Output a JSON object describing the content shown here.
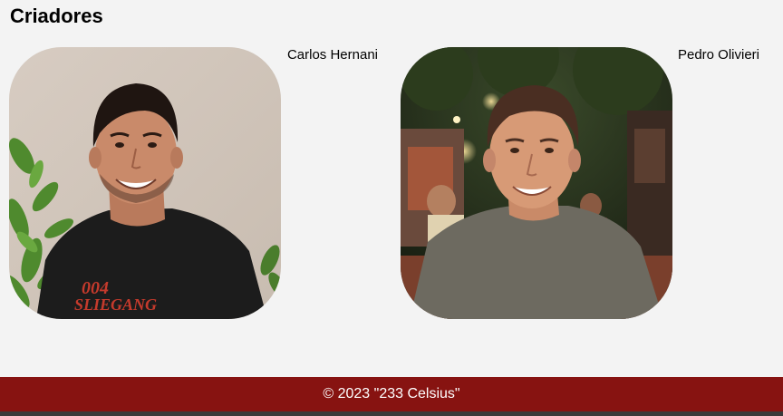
{
  "section": {
    "title": "Criadores"
  },
  "creators": [
    {
      "name": "Carlos Hernani",
      "photo_icon": "person-photo",
      "shirt_text": "004 SLIEGANG"
    },
    {
      "name": "Pedro Olivieri",
      "photo_icon": "person-photo"
    }
  ],
  "footer": {
    "copyright": "© 2023 \"233 Celsius\""
  },
  "colors": {
    "background": "#f3f3f3",
    "footer_bg": "#871311",
    "footer_text": "#ffffff"
  }
}
